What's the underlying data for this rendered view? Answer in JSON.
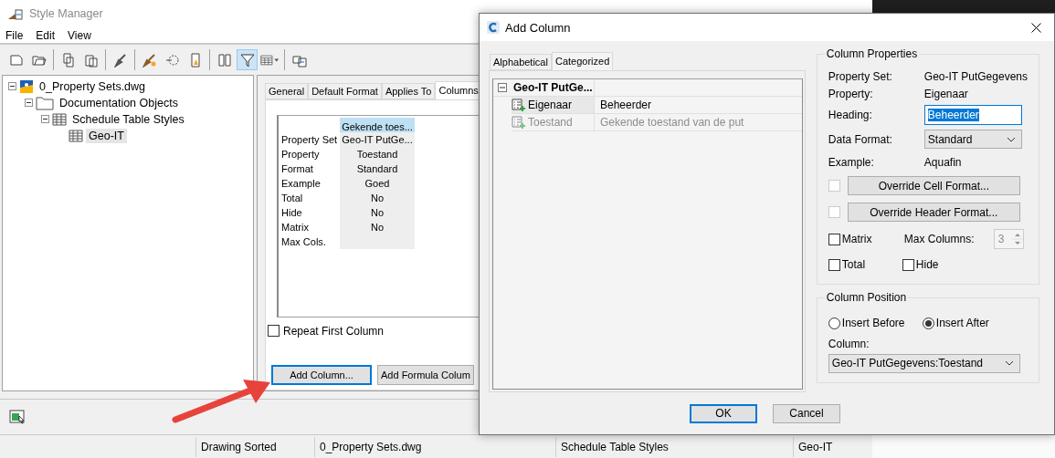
{
  "style_manager": {
    "title": "Style Manager",
    "menu": [
      "File",
      "Edit",
      "View"
    ],
    "toolbar": [
      [
        {
          "kind": "new",
          "selected": false
        },
        {
          "kind": "open",
          "selected": false
        }
      ],
      [
        {
          "kind": "copy",
          "selected": false
        },
        {
          "kind": "paste",
          "selected": false
        }
      ],
      [
        {
          "kind": "purge",
          "selected": false
        }
      ],
      [
        {
          "kind": "edit",
          "selected": false
        },
        {
          "kind": "select",
          "selected": false
        },
        {
          "kind": "properties",
          "selected": false
        }
      ],
      [
        {
          "kind": "toggle",
          "selected": false
        },
        {
          "kind": "filter",
          "selected": true
        },
        {
          "kind": "view",
          "selected": false
        }
      ],
      [
        {
          "kind": "external",
          "selected": false
        }
      ]
    ],
    "tree": [
      {
        "label": "0_Property Sets.dwg",
        "kind": "drawing",
        "expanded": true,
        "selected": false,
        "children": [
          {
            "label": "Documentation Objects",
            "kind": "folder",
            "expanded": true,
            "selected": false,
            "children": [
              {
                "label": "Schedule Table Styles",
                "kind": "table",
                "expanded": true,
                "selected": false,
                "children": [
                  {
                    "label": "Geo-IT",
                    "kind": "table",
                    "selected": true
                  }
                ]
              }
            ]
          }
        ]
      }
    ],
    "tabs": [
      {
        "label": "General",
        "selected": false
      },
      {
        "label": "Default Format",
        "selected": false
      },
      {
        "label": "Applies To",
        "selected": false
      },
      {
        "label": "Columns",
        "selected": true
      }
    ],
    "preview": {
      "header": "Gekende toes...",
      "rows": [
        {
          "label": "Property Set",
          "value": "Geo-IT PutGe..."
        },
        {
          "label": "Property",
          "value": "Toestand"
        },
        {
          "label": "Format",
          "value": "Standard"
        },
        {
          "label": "Example",
          "value": "Goed"
        },
        {
          "label": "Total",
          "value": "No"
        },
        {
          "label": "Hide",
          "value": "No"
        },
        {
          "label": "Matrix",
          "value": "No"
        },
        {
          "label": "Max Cols."
        }
      ]
    },
    "repeat_first_column": {
      "label": "Repeat First Column",
      "checked": false
    },
    "buttons": [
      {
        "label": "Add Column...",
        "focused": true
      },
      {
        "label": "Add Formula Colum",
        "focused": false
      }
    ],
    "status_bar": [
      "Drawing Sorted",
      "0_Property Sets.dwg",
      "Schedule Table Styles",
      "Geo-IT"
    ]
  },
  "dialog": {
    "title": "Add Column",
    "tabs": [
      {
        "label": "Alphabetical",
        "selected": false
      },
      {
        "label": "Categorized",
        "selected": true
      }
    ],
    "category": {
      "label": "Geo-IT PutGe...",
      "expanded": true,
      "rows": [
        {
          "name": "Eigenaar",
          "value": "Beheerder",
          "disabled": false,
          "selected": true
        },
        {
          "name": "Toestand",
          "value": "Gekende toestand van de put",
          "disabled": true,
          "selected": false
        }
      ]
    },
    "column_properties": {
      "title": "Column Properties",
      "info": [
        {
          "label": "Property Set:",
          "value": "Geo-IT PutGegevens"
        },
        {
          "label": "Property:",
          "value": "Eigenaar"
        }
      ],
      "heading": {
        "label": "Heading:",
        "value": "Beheerder",
        "text_selected": true
      },
      "data_format": {
        "label": "Data Format:",
        "value": "Standard"
      },
      "example": {
        "label": "Example:",
        "value": "Aquafin"
      },
      "overrides": [
        {
          "label": "Override Cell Format...",
          "checked": false,
          "disabled": true
        },
        {
          "label": "Override Header Format...",
          "checked": false,
          "disabled": true
        }
      ],
      "matrix": {
        "label": "Matrix",
        "checked": false
      },
      "max_columns": {
        "label": "Max Columns:",
        "value": "3",
        "disabled": true
      },
      "total": {
        "label": "Total",
        "checked": false
      },
      "hide": {
        "label": "Hide",
        "checked": false
      }
    },
    "column_position": {
      "title": "Column Position",
      "options": [
        {
          "label": "Insert Before",
          "selected": false
        },
        {
          "label": "Insert After",
          "selected": true
        }
      ],
      "column": {
        "label": "Column:",
        "value": "Geo-IT PutGegevens:Toestand"
      }
    },
    "buttons": [
      {
        "label": "OK",
        "default": true
      },
      {
        "label": "Cancel",
        "default": false
      }
    ]
  }
}
